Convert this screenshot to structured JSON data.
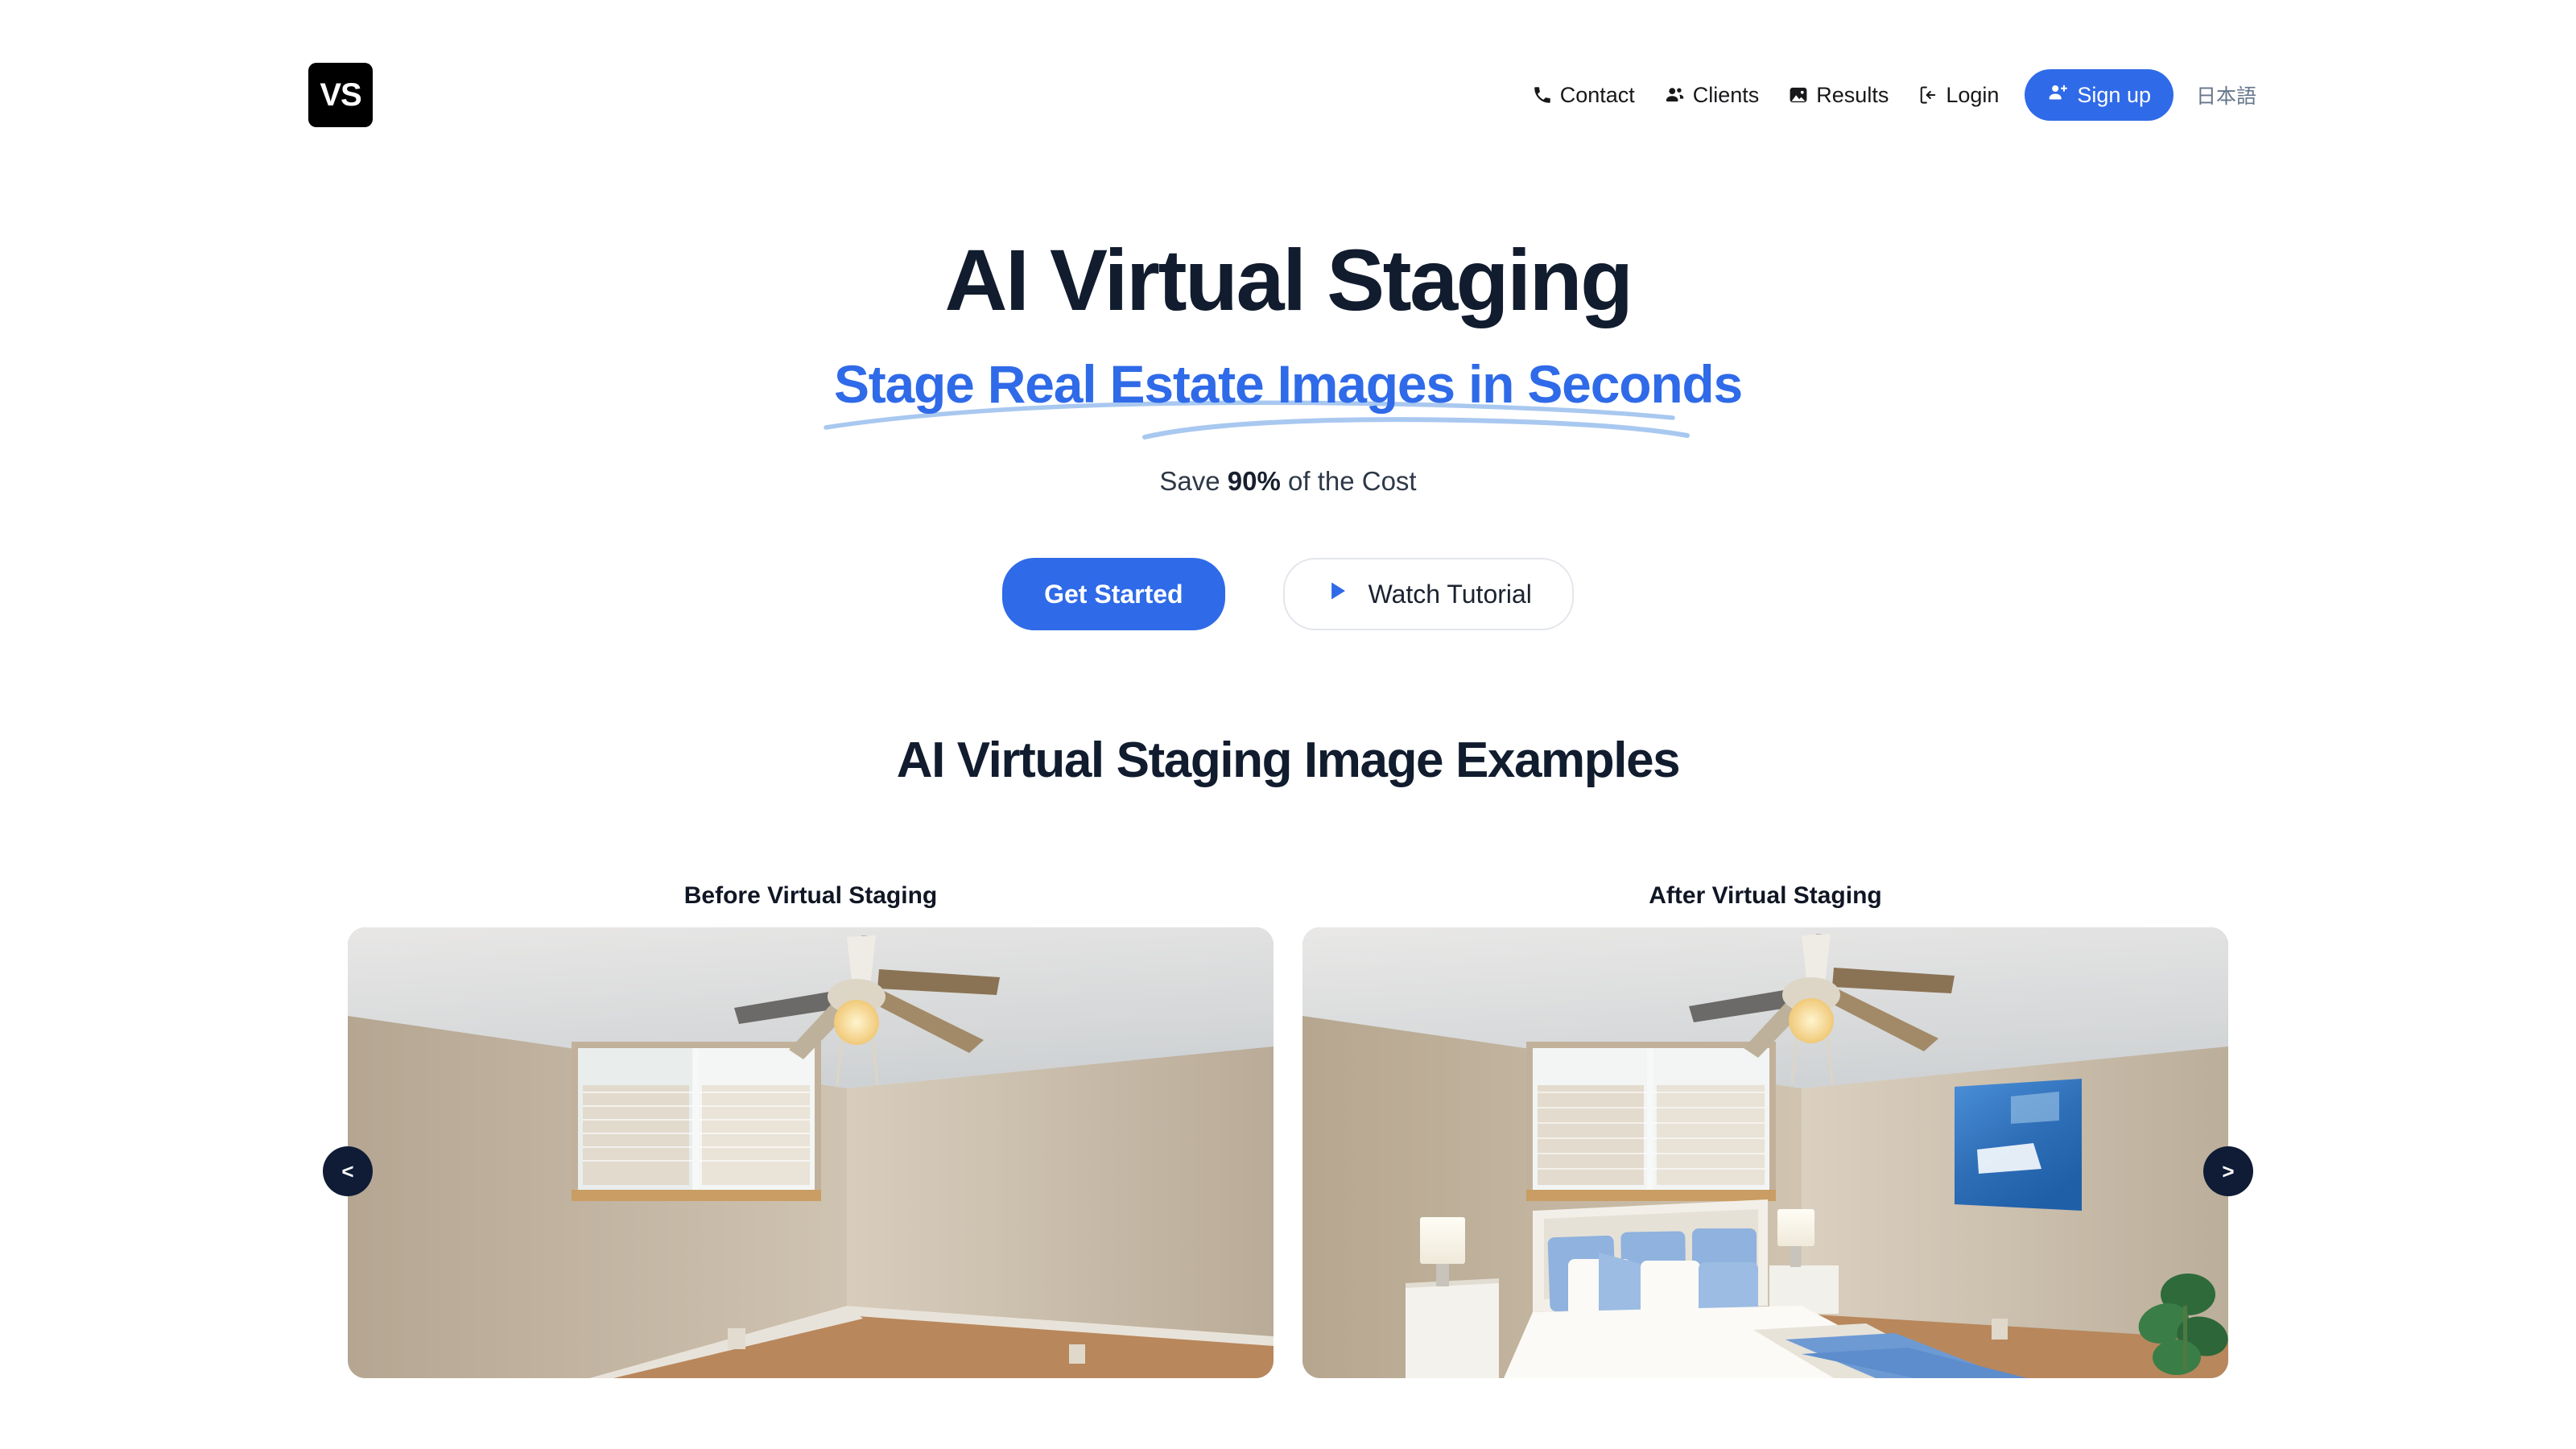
{
  "brand": {
    "logo_text": "VS"
  },
  "nav": {
    "items": [
      {
        "label": "Contact",
        "icon": "phone-icon"
      },
      {
        "label": "Clients",
        "icon": "people-icon"
      },
      {
        "label": "Results",
        "icon": "image-icon"
      },
      {
        "label": "Login",
        "icon": "sign-in-icon"
      }
    ],
    "signup_label": "Sign up",
    "signup_icon": "person-plus-icon",
    "language_label": "日本語",
    "accent_color": "#2f6ae8",
    "language_color": "#66768c"
  },
  "hero": {
    "title": "AI Virtual Staging",
    "subtitle": "Stage Real Estate Images in Seconds",
    "tagline_prefix": "Save ",
    "tagline_highlight": "90%",
    "tagline_suffix": " of the Cost",
    "title_color": "#111c2e",
    "subtitle_color": "#2f6ae8",
    "underline_color": "#a8c8f0"
  },
  "cta": {
    "primary_label": "Get Started",
    "secondary_label": "Watch Tutorial",
    "secondary_icon": "play-icon"
  },
  "examples": {
    "title": "AI Virtual Staging Image Examples",
    "before_label": "Before Virtual Staging",
    "after_label": "After Virtual Staging",
    "prev_label": "<",
    "next_label": ">",
    "prev_icon": "chevron-left-icon",
    "next_icon": "chevron-right-icon",
    "arrow_color": "#101c36"
  }
}
